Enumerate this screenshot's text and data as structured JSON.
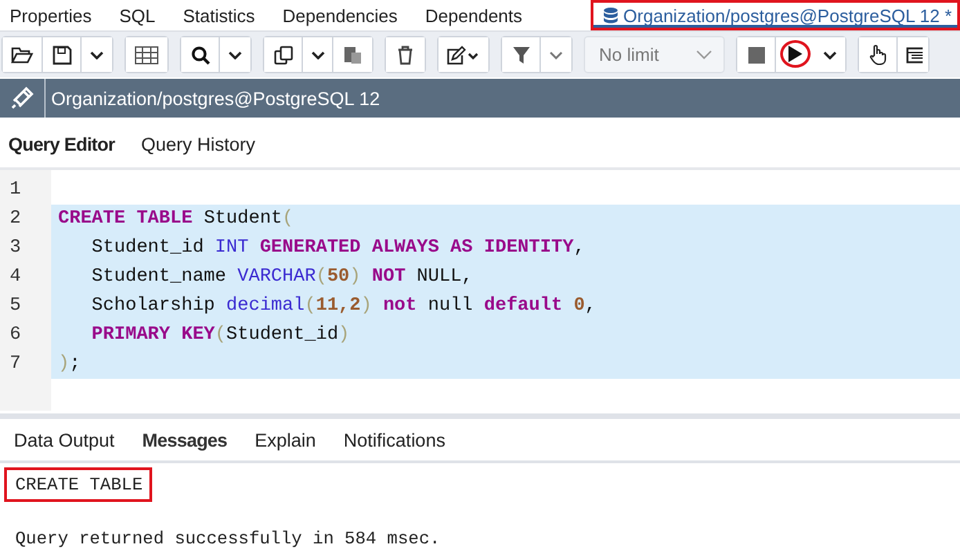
{
  "top_tabs": [
    {
      "label": "Properties",
      "selected": false,
      "marked": false
    },
    {
      "label": "SQL",
      "selected": false,
      "marked": false
    },
    {
      "label": "Statistics",
      "selected": false,
      "marked": false
    },
    {
      "label": "Dependencies",
      "selected": false,
      "marked": false
    },
    {
      "label": "Dependents",
      "selected": false,
      "marked": false
    },
    {
      "label": "Organization/postgres@PostgreSQL 12 *",
      "selected": true,
      "marked": true
    }
  ],
  "toolbar": {
    "limit": "No limit",
    "run_marked": true
  },
  "connection": "Organization/postgres@PostgreSQL 12",
  "editor_tabs": [
    {
      "label": "Query Editor",
      "selected": true
    },
    {
      "label": "Query History",
      "selected": false
    }
  ],
  "code_lines": [
    {
      "number": "1",
      "highlighted": false
    },
    {
      "number": "2",
      "highlighted": true,
      "tokens": [
        {
          "t": "CREATE TABLE",
          "kind": "kw"
        },
        {
          "t": " Student",
          "kind": "plain"
        },
        {
          "t": "(",
          "kind": "paren"
        }
      ]
    },
    {
      "number": "3",
      "highlighted": true,
      "indent": true,
      "tokens": [
        {
          "t": "Student_id ",
          "kind": "plain"
        },
        {
          "t": "INT",
          "kind": "type"
        },
        {
          "t": " GENERATED ALWAYS AS IDENTITY",
          "kind": "kw"
        },
        {
          "t": ",",
          "kind": "plain"
        }
      ]
    },
    {
      "number": "4",
      "highlighted": true,
      "indent": true,
      "tokens": [
        {
          "t": "Student_name ",
          "kind": "plain"
        },
        {
          "t": "VARCHAR",
          "kind": "type"
        },
        {
          "t": "(",
          "kind": "paren"
        },
        {
          "t": "50",
          "kind": "num"
        },
        {
          "t": ")",
          "kind": "paren"
        },
        {
          "t": " NOT",
          "kind": "kw"
        },
        {
          "t": " NULL,",
          "kind": "plain"
        }
      ]
    },
    {
      "number": "5",
      "highlighted": true,
      "indent": true,
      "tokens": [
        {
          "t": "Scholarship ",
          "kind": "plain"
        },
        {
          "t": "decimal",
          "kind": "type"
        },
        {
          "t": "(",
          "kind": "paren"
        },
        {
          "t": "11,2",
          "kind": "num"
        },
        {
          "t": ")",
          "kind": "paren"
        },
        {
          "t": " not",
          "kind": "kw"
        },
        {
          "t": " null ",
          "kind": "plain"
        },
        {
          "t": "default",
          "kind": "kw"
        },
        {
          "t": " 0",
          "kind": "num"
        },
        {
          "t": ",",
          "kind": "plain"
        }
      ]
    },
    {
      "number": "6",
      "highlighted": true,
      "indent": true,
      "tokens": [
        {
          "t": "PRIMARY KEY",
          "kind": "kw"
        },
        {
          "t": "(",
          "kind": "paren"
        },
        {
          "t": "Student_id",
          "kind": "plain"
        },
        {
          "t": ")",
          "kind": "paren"
        }
      ]
    },
    {
      "number": "7",
      "highlighted": true,
      "tokens": [
        {
          "t": ")",
          "kind": "paren"
        },
        {
          "t": ";",
          "kind": "plain"
        }
      ]
    }
  ],
  "output_tabs": [
    {
      "label": "Data Output",
      "selected": false
    },
    {
      "label": "Messages",
      "selected": true
    },
    {
      "label": "Explain",
      "selected": false
    },
    {
      "label": "Notifications",
      "selected": false
    }
  ],
  "messages": [
    {
      "text": "CREATE TABLE",
      "marked": true
    },
    {
      "text": "Query returned successfully in 584 msec.",
      "marked": false
    }
  ]
}
